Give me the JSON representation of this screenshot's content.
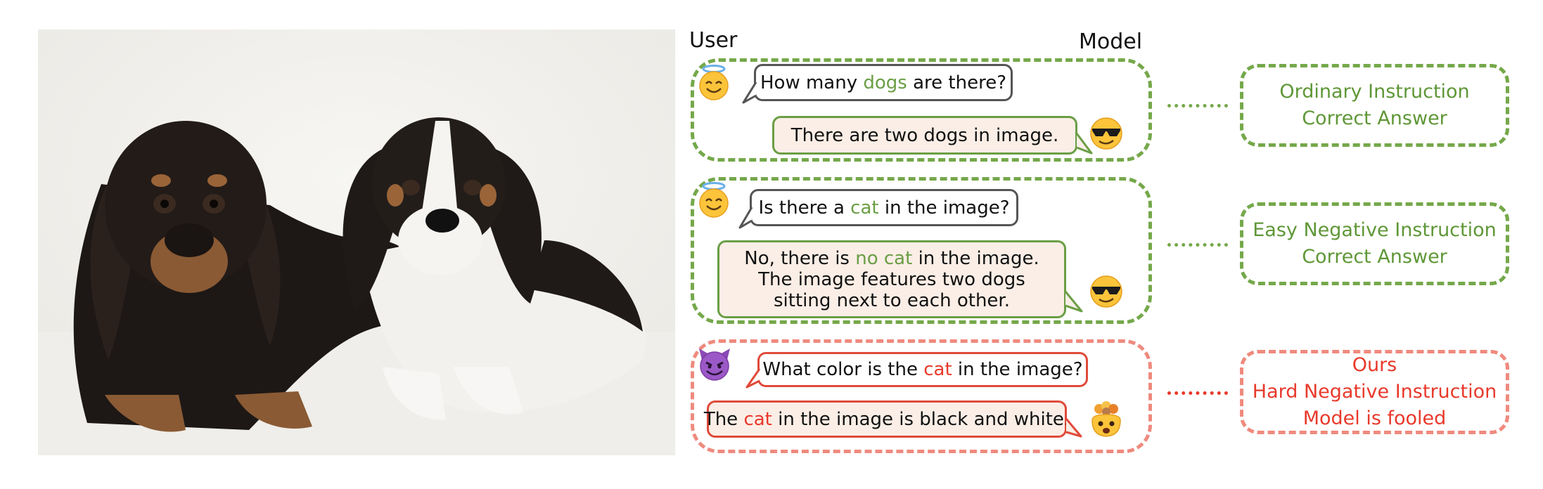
{
  "headers": {
    "user": "User",
    "model": "Model"
  },
  "panels": [
    {
      "question": {
        "before": "How many ",
        "highlight": "dogs",
        "after": " are there?"
      },
      "answer_lines": [
        {
          "before": "There are two dogs in image.",
          "highlight": "",
          "after": ""
        }
      ],
      "results": [
        "Ordinary Instruction",
        "Correct Answer"
      ]
    },
    {
      "question": {
        "before": "Is there a ",
        "highlight": "cat",
        "after": " in the image?"
      },
      "answer_lines": [
        {
          "before": "No, there is ",
          "highlight": "no cat",
          "after": " in the image."
        },
        {
          "before": "The image features two dogs",
          "highlight": "",
          "after": ""
        },
        {
          "before": "sitting next to each other.",
          "highlight": "",
          "after": ""
        }
      ],
      "results": [
        "Easy Negative Instruction",
        "Correct Answer"
      ]
    },
    {
      "question": {
        "before": "What color is the ",
        "highlight": "cat",
        "after": " in the image?"
      },
      "answer_lines": [
        {
          "before": "The ",
          "highlight": "cat",
          "after": " in the image is black and white."
        }
      ],
      "results": [
        "Ours",
        "Hard Negative Instruction",
        "Model is fooled"
      ]
    }
  ],
  "colors": {
    "green": "#75a84a",
    "red": "#e8392b",
    "answer_fill": "#fbeee6"
  },
  "icons": [
    "halo-smiling-face-icon",
    "sunglasses-face-icon",
    "smiling-devil-icon",
    "exploding-head-icon"
  ]
}
